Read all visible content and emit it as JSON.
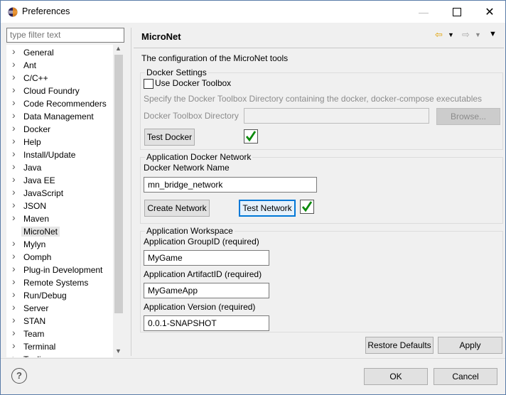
{
  "window": {
    "title": "Preferences"
  },
  "filter": {
    "placeholder": "type filter text"
  },
  "tree": {
    "items": [
      {
        "label": "General"
      },
      {
        "label": "Ant"
      },
      {
        "label": "C/C++"
      },
      {
        "label": "Cloud Foundry"
      },
      {
        "label": "Code Recommenders"
      },
      {
        "label": "Data Management"
      },
      {
        "label": "Docker"
      },
      {
        "label": "Help"
      },
      {
        "label": "Install/Update"
      },
      {
        "label": "Java"
      },
      {
        "label": "Java EE"
      },
      {
        "label": "JavaScript"
      },
      {
        "label": "JSON"
      },
      {
        "label": "Maven"
      },
      {
        "label": "MicroNet"
      },
      {
        "label": "Mylyn"
      },
      {
        "label": "Oomph"
      },
      {
        "label": "Plug-in Development"
      },
      {
        "label": "Remote Systems"
      },
      {
        "label": "Run/Debug"
      },
      {
        "label": "Server"
      },
      {
        "label": "STAN"
      },
      {
        "label": "Team"
      },
      {
        "label": "Terminal"
      },
      {
        "label": "Tooling"
      }
    ],
    "selected": "MicroNet"
  },
  "page": {
    "title": "MicroNet",
    "description": "The configuration of the MicroNet tools"
  },
  "docker": {
    "legend": "Docker Settings",
    "use_toolbox_label": "Use Docker Toolbox",
    "use_toolbox_checked": false,
    "hint": "Specify the Docker Toolbox Directory containing the docker, docker-compose executables",
    "dir_label": "Docker Toolbox Directory",
    "dir_value": "",
    "browse_label": "Browse...",
    "test_label": "Test Docker"
  },
  "network": {
    "legend": "Application Docker Network",
    "name_label": "Docker Network Name",
    "name_value": "mn_bridge_network",
    "create_label": "Create Network",
    "test_label": "Test Network"
  },
  "workspace": {
    "legend": "Application Workspace",
    "group_label": "Application GroupID (required)",
    "group_value": "MyGame",
    "artifact_label": "Application ArtifactID (required)",
    "artifact_value": "MyGameApp",
    "version_label": "Application Version (required)",
    "version_value": "0.0.1-SNAPSHOT"
  },
  "actions": {
    "restore_label": "Restore Defaults",
    "apply_label": "Apply",
    "ok_label": "OK",
    "cancel_label": "Cancel"
  },
  "icons": {
    "app": "eclipse-icon",
    "back": "back-arrow-icon",
    "forward": "forward-arrow-icon",
    "menu": "view-menu-icon",
    "help": "help-icon",
    "check": "green-check-icon"
  },
  "colors": {
    "check": "#0a8a0a",
    "back_arrow": "#e0a000",
    "focus": "#0078d7"
  }
}
